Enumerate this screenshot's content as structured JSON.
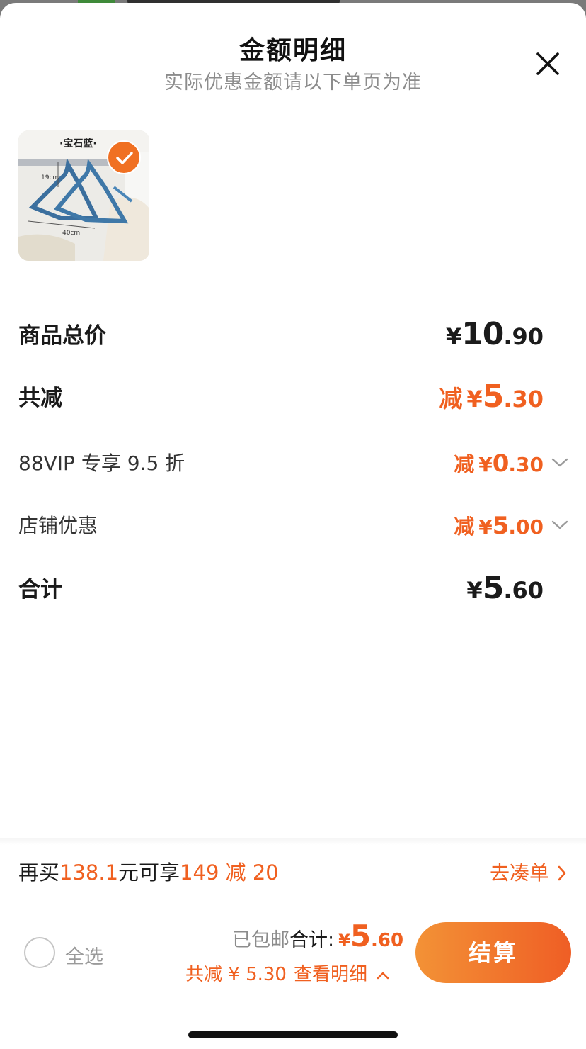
{
  "header": {
    "title": "金额明细",
    "subtitle": "实际优惠金额请以下单页为准"
  },
  "product": {
    "label": "·宝石蓝·",
    "dim_height": "19cm",
    "dim_width": "40cm",
    "selected": true
  },
  "summary": {
    "goods_total": {
      "label": "商品总价",
      "currency": "¥",
      "int": "10",
      "dec": ".90"
    },
    "discount_total": {
      "label": "共减",
      "prefix": "减",
      "currency": "¥",
      "int": "5",
      "dec": ".30"
    },
    "vip": {
      "label": "88VIP 专享 9.5 折",
      "prefix": "减",
      "currency": "¥",
      "int": "0",
      "dec": ".30"
    },
    "shop": {
      "label": "店铺优惠",
      "prefix": "减",
      "currency": "¥",
      "int": "5",
      "dec": ".00"
    },
    "total": {
      "label": "合计",
      "currency": "¥",
      "int": "5",
      "dec": ".60"
    }
  },
  "promo": {
    "pre": "再买",
    "amount": "138.1",
    "mid": "元可享",
    "deal": "149 减 20",
    "link": "去凑单"
  },
  "footer": {
    "select_all": "全选",
    "shipping": "已包邮",
    "total_label": "合计:",
    "currency": "¥",
    "total_int": "5",
    "total_dec": ".60",
    "saved_text": "共减 ¥ 5.30",
    "detail_link": "查看明细",
    "checkout": "结算"
  },
  "colors": {
    "accent": "#f06020",
    "button_start": "#f39236",
    "button_end": "#ef5e25"
  },
  "icons": [
    "close-icon",
    "check-icon",
    "chevron-down-icon",
    "chevron-right-icon",
    "chevron-up-icon"
  ]
}
